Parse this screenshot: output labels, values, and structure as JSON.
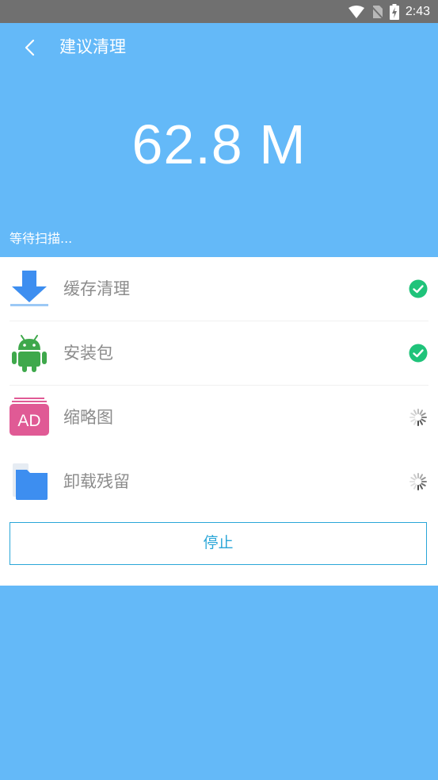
{
  "status_bar": {
    "time": "2:43"
  },
  "header": {
    "title": "建议清理",
    "size_display": "62.8 M",
    "scan_status": "等待扫描..."
  },
  "items": [
    {
      "label": "缓存清理",
      "state": "done",
      "icon": "download-icon"
    },
    {
      "label": "安装包",
      "state": "done",
      "icon": "android-icon"
    },
    {
      "label": "缩略图",
      "state": "scanning",
      "icon": "ad-icon",
      "icon_text": "AD"
    },
    {
      "label": "卸载残留",
      "state": "scanning",
      "icon": "folder-icon"
    }
  ],
  "stop_button": {
    "label": "停止"
  },
  "colors": {
    "primary_blue": "#64b9f8",
    "check_green": "#1fc37a",
    "button_blue": "#2aa6d8",
    "ad_pink": "#e05a95",
    "android_green": "#3ea84b",
    "folder_blue": "#3d8ef0"
  }
}
